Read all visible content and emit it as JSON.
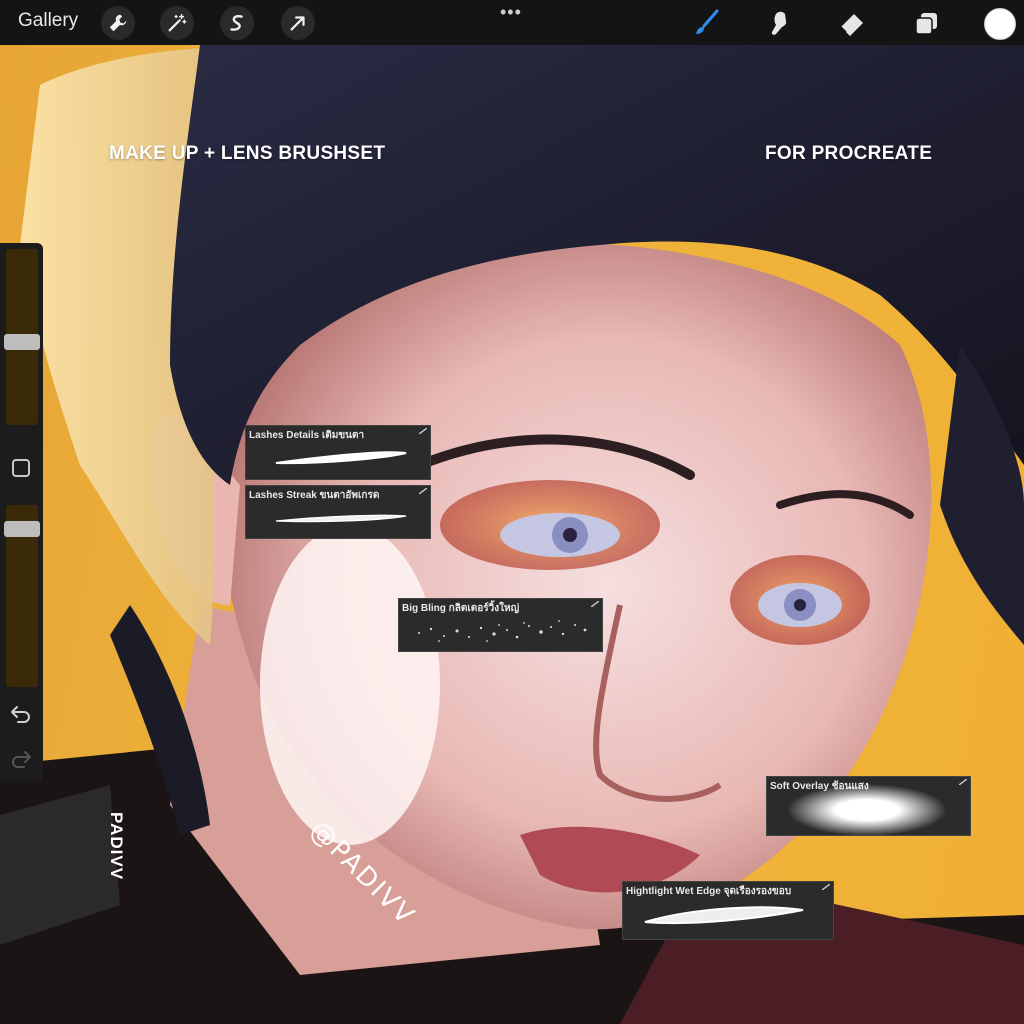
{
  "topbar": {
    "gallery_label": "Gallery",
    "more_label": "•••",
    "tools_left": [
      "wrench-icon",
      "magic-wand-icon",
      "selection-icon",
      "transform-arrow-icon"
    ],
    "tools_right": [
      "brush-icon",
      "smudge-icon",
      "eraser-icon",
      "layers-icon",
      "color-icon"
    ],
    "active_tool": "brush-icon",
    "accent_color": "#2f8ef0",
    "current_color": "#ffffff"
  },
  "sidebar": {
    "brush_size_level": 0.47,
    "opacity_level": 0.3
  },
  "canvas": {
    "headline_left": "MAKE UP + LENS BRUSHSET",
    "headline_right": "FOR PROCREATE",
    "watermark": "PADIVV",
    "signature": "@PADIVV",
    "background_color": "#efb43a"
  },
  "brushes": [
    {
      "name": "Lashes Details เติมขนตา"
    },
    {
      "name": "Lashes Streak ขนตาอัพเกรด"
    },
    {
      "name": "Big Bling กลิตเตอร์วิ้งใหญ่"
    },
    {
      "name": "Soft Overlay ช้อนแสง"
    },
    {
      "name": "Hightlight Wet Edge จุดเรืองรองขอบ"
    }
  ]
}
